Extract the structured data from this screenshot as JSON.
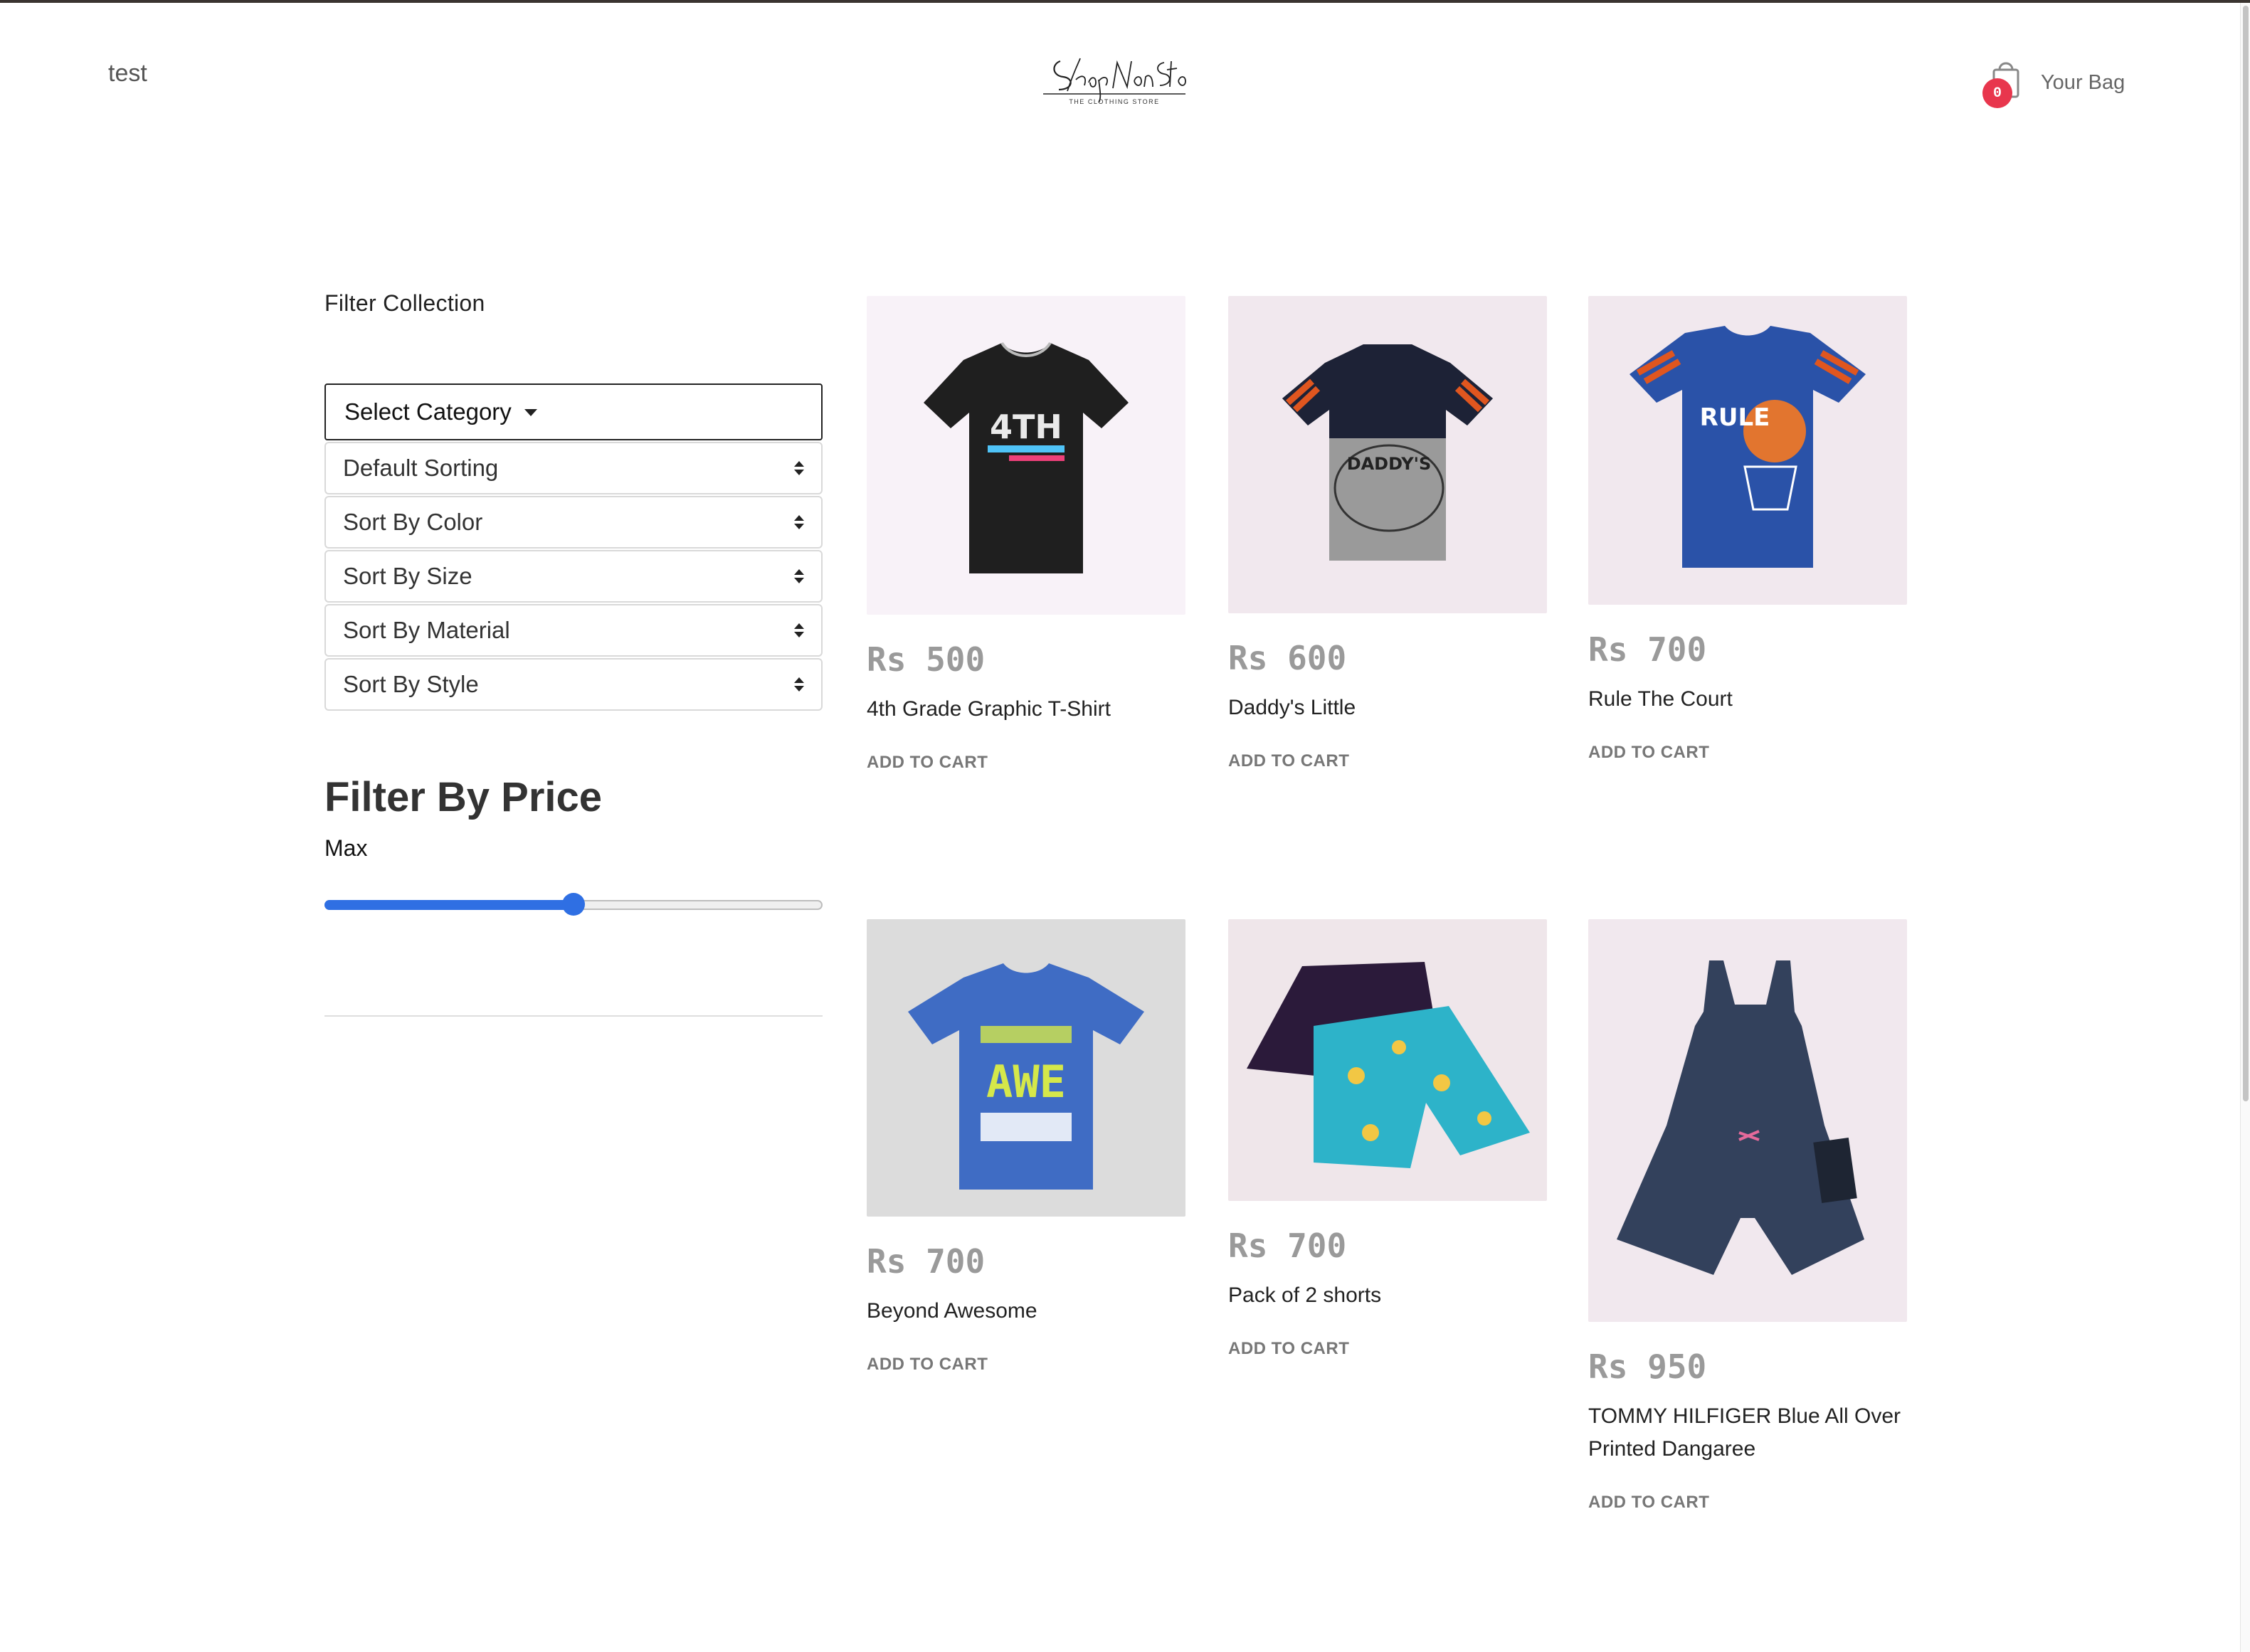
{
  "header": {
    "user": "test",
    "logo_text": "ShopNonStop",
    "logo_subtitle": "THE CLOTHING STORE",
    "bag_count": "0",
    "bag_label": "Your Bag"
  },
  "sidebar": {
    "title": "Filter Collection",
    "category_label": "Select Category",
    "sorts": [
      "Default Sorting",
      "Sort By Color",
      "Sort By Size",
      "Sort By Material",
      "Sort By Style"
    ],
    "price_heading": "Filter By Price",
    "price_max_label": "Max",
    "price_slider_fraction": 0.5
  },
  "products": [
    {
      "price": "Rs 500",
      "name": "4th Grade Graphic T-Shirt",
      "add_label": "ADD TO CART",
      "image_icon": "black-tshirt-4th-grade",
      "bg": "#f8f2f8",
      "garment": "#1f1f1f",
      "graphic": "4TH"
    },
    {
      "price": "Rs 600",
      "name": "Daddy's Little",
      "add_label": "ADD TO CART",
      "image_icon": "grey-tshirt-daddys-little",
      "bg": "#f1e8ee",
      "garment": "#9a9a9a",
      "graphic": "DADDY'S"
    },
    {
      "price": "Rs 700",
      "name": "Rule The Court",
      "add_label": "ADD TO CART",
      "image_icon": "blue-tshirt-rule-the-court",
      "bg": "#f1e8ee",
      "garment": "#2a52a8",
      "graphic": "RULE"
    },
    {
      "price": "Rs 700",
      "name": "Beyond Awesome",
      "add_label": "ADD TO CART",
      "image_icon": "blue-tshirt-beyond-awesome",
      "bg": "#dcdcdc",
      "garment": "#3f6cc4",
      "graphic": "AWE"
    },
    {
      "price": "Rs 700",
      "name": "Pack of 2 shorts",
      "add_label": "ADD TO CART",
      "image_icon": "pair-of-shorts",
      "bg": "#efe6ea",
      "garment": "#2b1a3a",
      "graphic": ""
    },
    {
      "price": "Rs 950",
      "name": "TOMMY HILFIGER Blue All Over Printed Dangaree",
      "add_label": "ADD TO CART",
      "image_icon": "navy-dungaree",
      "bg": "#f1e8ee",
      "garment": "#33415c",
      "graphic": ""
    }
  ]
}
